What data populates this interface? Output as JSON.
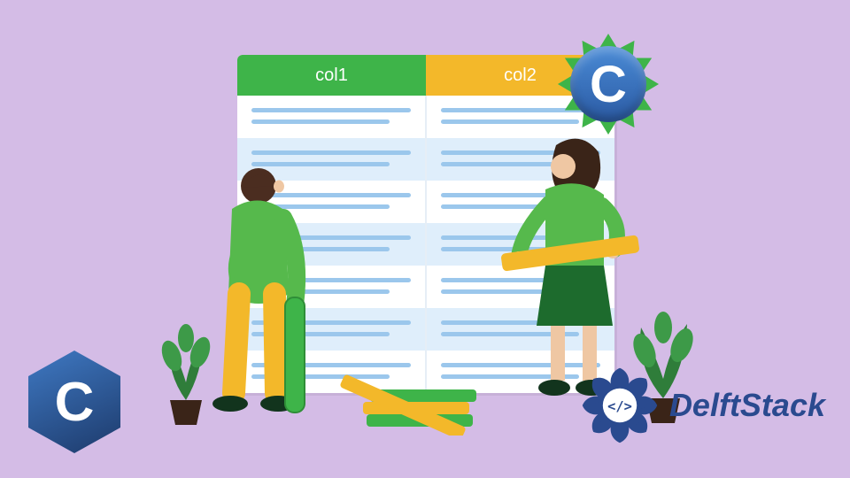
{
  "table": {
    "headers": [
      "col1",
      "col2"
    ],
    "header_colors": [
      "#3eb449",
      "#f3b82a"
    ],
    "row_count": 7
  },
  "badges": {
    "top_right": {
      "glyph": "C",
      "shape": "starburst-disc",
      "colors": [
        "#3eb449",
        "#2b5aa3"
      ]
    },
    "bottom_left": {
      "glyph": "C",
      "shape": "hexagon",
      "color": "#1d3a6b"
    }
  },
  "brand": {
    "name": "DelftStack",
    "mark_color": "#2a4a8f",
    "glyph": "</>"
  },
  "illustration": {
    "people": 2,
    "plants": 2,
    "planks_pile": true
  },
  "palette": {
    "background": "#d4bce6",
    "green": "#3eb449",
    "yellow": "#f3b82a",
    "blue": "#2b5aa3"
  }
}
